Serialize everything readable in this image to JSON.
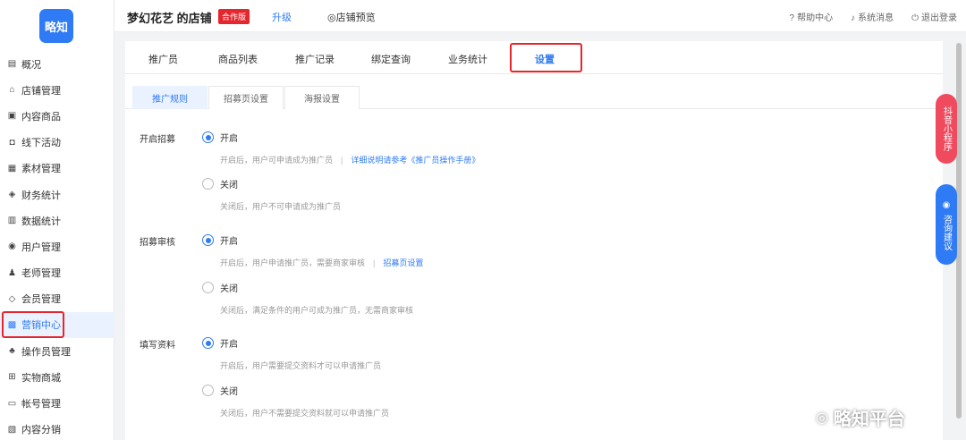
{
  "logo": "略知",
  "sidebar": {
    "items": [
      {
        "label": "概况",
        "icon": "▤"
      },
      {
        "label": "店铺管理",
        "icon": "⌂"
      },
      {
        "label": "内容商品",
        "icon": "▣"
      },
      {
        "label": "线下活动",
        "icon": "◘"
      },
      {
        "label": "素材管理",
        "icon": "▦"
      },
      {
        "label": "财务统计",
        "icon": "◈"
      },
      {
        "label": "数据统计",
        "icon": "▥"
      },
      {
        "label": "用户管理",
        "icon": "◉"
      },
      {
        "label": "老师管理",
        "icon": "♟"
      },
      {
        "label": "会员管理",
        "icon": "◇"
      },
      {
        "label": "营销中心",
        "icon": "▩"
      },
      {
        "label": "操作员管理",
        "icon": "♣"
      },
      {
        "label": "实物商城",
        "icon": "⊞"
      },
      {
        "label": "帐号管理",
        "icon": "▭"
      },
      {
        "label": "内容分销",
        "icon": "▧"
      }
    ],
    "active_index": 10
  },
  "topbar": {
    "shop_name": "梦幻花艺 的店铺",
    "edition_badge": "合作版",
    "upgrade": "升级",
    "preview": "店铺预览",
    "help": "帮助中心",
    "messages": "系统消息",
    "logout": "退出登录"
  },
  "tabs": [
    "推广员",
    "商品列表",
    "推广记录",
    "绑定查询",
    "业务统计",
    "设置"
  ],
  "active_tab": "设置",
  "subtabs": [
    "推广规则",
    "招募页设置",
    "海报设置"
  ],
  "settings": {
    "recruit": {
      "label": "开启招募",
      "on": "开启",
      "on_hint": "开启后，用户可申请成为推广员",
      "on_link": "详细说明请参考《推广员操作手册》",
      "off": "关闭",
      "off_hint": "关闭后，用户不可申请成为推广员"
    },
    "review": {
      "label": "招募审核",
      "on": "开启",
      "on_hint": "开启后，用户申请推广员，需要商家审核",
      "on_link": "招募页设置",
      "off": "关闭",
      "off_hint": "关闭后，满足条件的用户可成为推广员，无需商家审核"
    },
    "profile": {
      "label": "填写资料",
      "on": "开启",
      "on_hint": "开启后，用户需要提交资料才可以申请推广员",
      "off": "关闭",
      "off_hint": "关闭后，用户不需要提交资料就可以申请推广员"
    }
  },
  "float_red": "抖音小程序",
  "float_blue": "咨询建议",
  "watermark": "略知平台"
}
